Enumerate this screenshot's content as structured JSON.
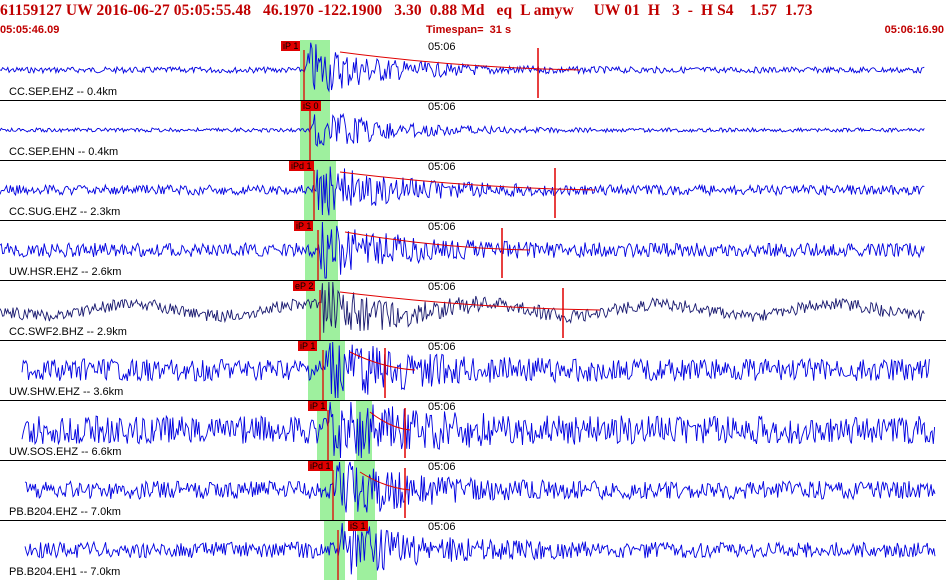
{
  "header": {
    "title": "61159127 UW 2016-06-27 05:05:55.48   46.1970 -122.1900   3.30  0.88 Md   eq  L amyw     UW 01  H   3  -  H S4    1.57  1.73",
    "start_time": "05:05:46.09",
    "timespan": "Timespan=  31 s",
    "end_time": "05:06:16.90"
  },
  "colors": {
    "header_text": "#c00000",
    "trace_blue": "#0000e0",
    "trace_navy": "#1a1a70",
    "pick_red": "#e00000",
    "window_green": "#9ef09e"
  },
  "channels": [
    {
      "label": "CC.SEP.EHZ -- 0.4km",
      "time_mark": "05:06",
      "pick": "iP 1",
      "color": "blue"
    },
    {
      "label": "CC.SEP.EHN -- 0.4km",
      "time_mark": "05:06",
      "pick": "iS 0",
      "color": "blue"
    },
    {
      "label": "CC.SUG.EHZ -- 2.3km",
      "time_mark": "05:06",
      "pick": "iPd 1",
      "color": "blue"
    },
    {
      "label": "UW.HSR.EHZ -- 2.6km",
      "time_mark": "05:06",
      "pick": "iP 1",
      "color": "blue"
    },
    {
      "label": "CC.SWF2.BHZ -- 2.9km",
      "time_mark": "05:06",
      "pick": "eP 2",
      "color": "navy"
    },
    {
      "label": "UW.SHW.EHZ -- 3.6km",
      "time_mark": "05:06",
      "pick": "iP 1",
      "color": "blue"
    },
    {
      "label": "UW.SOS.EHZ -- 6.6km",
      "time_mark": "05:06",
      "pick": "iP 1",
      "color": "blue"
    },
    {
      "label": "PB.B204.EHZ -- 7.0km",
      "time_mark": "05:06",
      "pick": "iPd 1",
      "color": "blue"
    },
    {
      "label": "PB.B204.EH1 -- 7.0km",
      "time_mark": "05:06",
      "pick": "iS 1",
      "color": "blue"
    }
  ]
}
